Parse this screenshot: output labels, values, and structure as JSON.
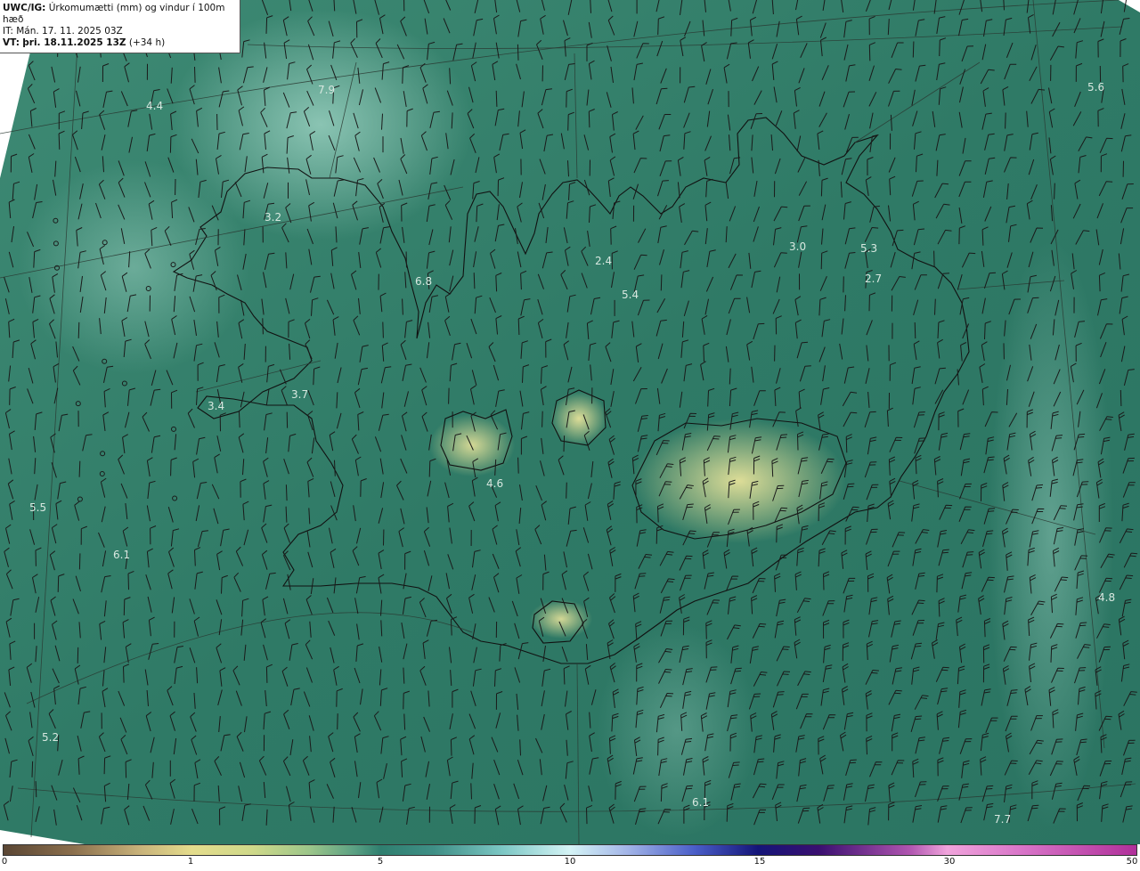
{
  "header": {
    "model": "UWC/IG:",
    "product": "Úrkomumætti (mm) og vindur í 100m hæð",
    "init_time": "IT: Mán. 17. 11. 2025 03Z",
    "valid_label": "VT:",
    "valid_time": "þri. 18.11.2025 13Z",
    "lead": "(+34 h)"
  },
  "map_values": [
    "4.4",
    "7.9",
    "3.2",
    "6.8",
    "2.4",
    "5.4",
    "3.0",
    "5.3",
    "2.7",
    "5.6",
    "3.7",
    "3.4",
    "4.6",
    "5.5",
    "6.1",
    "4.8",
    "5.2",
    "6.1",
    "7.7"
  ],
  "colorbar": {
    "ticks": [
      "0",
      "1",
      "5",
      "10",
      "15",
      "30",
      "50"
    ]
  },
  "colors": {
    "sea": "#3f8a76",
    "land_low": "#8fbf86",
    "land_high": "#d8dc8c",
    "wake": "#7cc3b3"
  }
}
